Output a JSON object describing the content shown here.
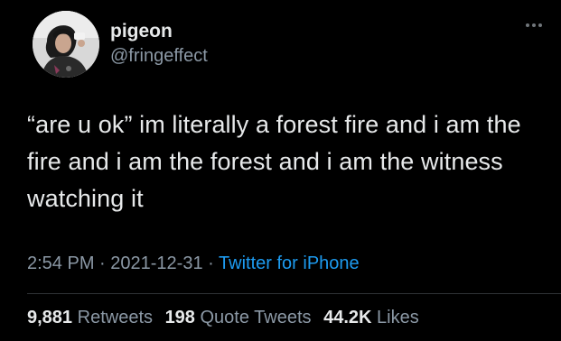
{
  "user": {
    "display_name": "pigeon",
    "handle": "@fringeffect"
  },
  "tweet": {
    "text": "“are u ok” im literally a forest fire and i am the fire and i am the forest and i am the witness watching it",
    "time": "2:54 PM",
    "separator": "·",
    "date": "2021-12-31",
    "source": "Twitter for iPhone"
  },
  "stats": {
    "retweets_count": "9,881",
    "retweets_label": "Retweets",
    "quote_tweets_count": "198",
    "quote_tweets_label": "Quote Tweets",
    "likes_count": "44.2K",
    "likes_label": "Likes"
  },
  "icons": {
    "more": "more-options-icon"
  },
  "colors": {
    "background": "#000000",
    "text": "#e7e9ea",
    "secondary": "#8b98a5",
    "link": "#1d9bf0",
    "divider": "#2f3336"
  }
}
